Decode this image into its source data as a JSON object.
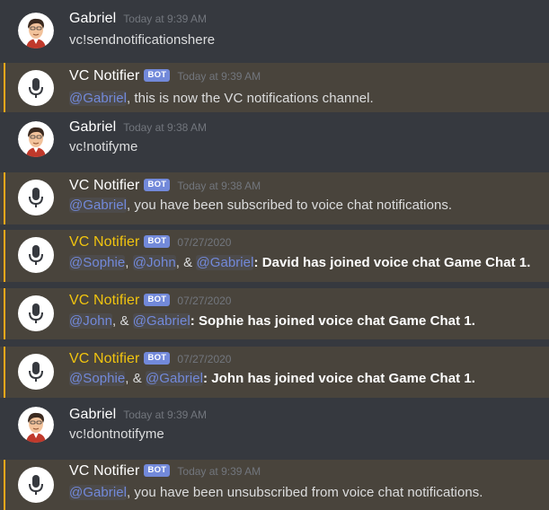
{
  "messages": [
    {
      "author": "Gabriel",
      "timestamp": "Today at 9:39 AM",
      "text": "vc!sendnotificationshere"
    },
    {
      "author": "VC Notifier",
      "bot_tag": "BOT",
      "timestamp": "Today at 9:39 AM",
      "mention": "@Gabriel",
      "text": ", this is now the VC notifications channel."
    },
    {
      "author": "Gabriel",
      "timestamp": "Today at 9:38 AM",
      "text": "vc!notifyme"
    },
    {
      "author": "VC Notifier",
      "bot_tag": "BOT",
      "timestamp": "Today at 9:38 AM",
      "mention": "@Gabriel",
      "text": ", you have been subscribed to voice chat notifications."
    },
    {
      "author": "VC Notifier",
      "bot_tag": "BOT",
      "timestamp": "07/27/2020",
      "mentions": [
        "@Sophie",
        "@John",
        "@Gabriel"
      ],
      "sep1": ", ",
      "sep2": ", & ",
      "colon": ": ",
      "bold": "David has joined voice chat Game Chat 1."
    },
    {
      "author": "VC Notifier",
      "bot_tag": "BOT",
      "timestamp": "07/27/2020",
      "mentions": [
        "@John",
        "@Gabriel"
      ],
      "sep1": ", & ",
      "colon": ": ",
      "bold": "Sophie has joined voice chat Game Chat 1."
    },
    {
      "author": "VC Notifier",
      "bot_tag": "BOT",
      "timestamp": "07/27/2020",
      "mentions": [
        "@Sophie",
        "@Gabriel"
      ],
      "sep1": ", & ",
      "colon": ": ",
      "bold": "John has joined voice chat Game Chat 1."
    },
    {
      "author": "Gabriel",
      "timestamp": "Today at 9:39 AM",
      "text": "vc!dontnotifyme"
    },
    {
      "author": "VC Notifier",
      "bot_tag": "BOT",
      "timestamp": "Today at 9:39 AM",
      "mention": "@Gabriel",
      "text": ", you have been unsubscribed from voice chat notifications."
    }
  ],
  "icons": {
    "user_avatar": "cartoon-man-avatar",
    "bot_avatar": "microphone-icon"
  },
  "colors": {
    "background": "#36393f",
    "highlight_background": "#49443c",
    "highlight_bar": "#faa81a",
    "mention": "#7289da",
    "bot_tag": "#7289da",
    "gold_name": "#f1c40f",
    "timestamp": "#72767d"
  }
}
